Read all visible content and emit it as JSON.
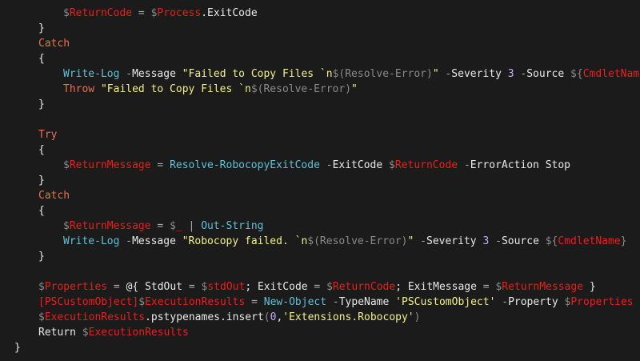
{
  "editor": {
    "language": "PowerShell",
    "colors": {
      "background": "#1b1b1b",
      "plain": "#e8e8e8",
      "variable": "#f01c1c",
      "keyword": "#e8714f",
      "command": "#5ec2d6",
      "string": "#f2f08a",
      "number": "#c9a8ff",
      "operator": "#a9a9a9"
    },
    "lines": [
      {
        "indent": 2,
        "tokens": [
          [
            "dollar",
            "$"
          ],
          [
            "var",
            "ReturnCode"
          ],
          [
            "op",
            " = "
          ],
          [
            "dollar",
            "$"
          ],
          [
            "var",
            "Process"
          ],
          [
            "plain",
            ".ExitCode"
          ]
        ]
      },
      {
        "indent": 1,
        "tokens": [
          [
            "plain",
            "}"
          ]
        ]
      },
      {
        "indent": 1,
        "tokens": [
          [
            "kw",
            "Catch"
          ]
        ]
      },
      {
        "indent": 1,
        "tokens": [
          [
            "plain",
            "{"
          ]
        ]
      },
      {
        "indent": 2,
        "tokens": [
          [
            "cmd",
            "Write-Log"
          ],
          [
            "op",
            " -"
          ],
          [
            "param",
            "Message "
          ],
          [
            "str",
            "\"Failed to Copy Files `n"
          ],
          [
            "dollar",
            "$"
          ],
          [
            "paren",
            "(Resolve-Error)"
          ],
          [
            "str",
            "\""
          ],
          [
            "op",
            " -"
          ],
          [
            "param",
            "Severity "
          ],
          [
            "num",
            "3"
          ],
          [
            "op",
            " -"
          ],
          [
            "param",
            "Source "
          ],
          [
            "dollar",
            "${"
          ],
          [
            "var",
            "CmdletName"
          ],
          [
            "dollar",
            "}"
          ]
        ]
      },
      {
        "indent": 2,
        "tokens": [
          [
            "kw",
            "Throw "
          ],
          [
            "str",
            "\"Failed to Copy Files `n"
          ],
          [
            "dollar",
            "$"
          ],
          [
            "paren",
            "(Resolve-Error)"
          ],
          [
            "str",
            "\""
          ]
        ]
      },
      {
        "indent": 1,
        "tokens": [
          [
            "plain",
            "}"
          ]
        ]
      },
      {
        "indent": 0,
        "tokens": []
      },
      {
        "indent": 1,
        "tokens": [
          [
            "kw",
            "Try"
          ]
        ]
      },
      {
        "indent": 1,
        "tokens": [
          [
            "plain",
            "{"
          ]
        ]
      },
      {
        "indent": 2,
        "tokens": [
          [
            "dollar",
            "$"
          ],
          [
            "var",
            "ReturnMessage"
          ],
          [
            "op",
            " = "
          ],
          [
            "cmd",
            "Resolve-RobocopyExitCode"
          ],
          [
            "op",
            " -"
          ],
          [
            "param",
            "ExitCode "
          ],
          [
            "dollar",
            "$"
          ],
          [
            "var",
            "ReturnCode"
          ],
          [
            "op",
            " -"
          ],
          [
            "param",
            "ErrorAction Stop"
          ]
        ]
      },
      {
        "indent": 1,
        "tokens": [
          [
            "plain",
            "}"
          ]
        ]
      },
      {
        "indent": 1,
        "tokens": [
          [
            "kw",
            "Catch"
          ]
        ]
      },
      {
        "indent": 1,
        "tokens": [
          [
            "plain",
            "{"
          ]
        ]
      },
      {
        "indent": 2,
        "tokens": [
          [
            "dollar",
            "$"
          ],
          [
            "var",
            "ReturnMessage"
          ],
          [
            "op",
            " = "
          ],
          [
            "dollar",
            "$"
          ],
          [
            "var",
            "_"
          ],
          [
            "op",
            " | "
          ],
          [
            "cmd",
            "Out-String"
          ]
        ]
      },
      {
        "indent": 2,
        "tokens": [
          [
            "cmd",
            "Write-Log"
          ],
          [
            "op",
            " -"
          ],
          [
            "param",
            "Message "
          ],
          [
            "str",
            "\"Robocopy failed. `n"
          ],
          [
            "dollar",
            "$"
          ],
          [
            "paren",
            "(Resolve-Error)"
          ],
          [
            "str",
            "\""
          ],
          [
            "op",
            " -"
          ],
          [
            "param",
            "Severity "
          ],
          [
            "num",
            "3"
          ],
          [
            "op",
            " -"
          ],
          [
            "param",
            "Source "
          ],
          [
            "dollar",
            "${"
          ],
          [
            "var",
            "CmdletName"
          ],
          [
            "dollar",
            "}"
          ]
        ]
      },
      {
        "indent": 1,
        "tokens": [
          [
            "plain",
            "}"
          ]
        ]
      },
      {
        "indent": 0,
        "tokens": []
      },
      {
        "indent": 1,
        "tokens": [
          [
            "dollar",
            "$"
          ],
          [
            "var",
            "Properties"
          ],
          [
            "op",
            " = "
          ],
          [
            "plain",
            "@{ StdOut "
          ],
          [
            "op",
            "= "
          ],
          [
            "dollar",
            "$"
          ],
          [
            "var",
            "stdOut"
          ],
          [
            "plain",
            "; ExitCode "
          ],
          [
            "op",
            "= "
          ],
          [
            "dollar",
            "$"
          ],
          [
            "var",
            "ReturnCode"
          ],
          [
            "plain",
            "; ExitMessage "
          ],
          [
            "op",
            "= "
          ],
          [
            "dollar",
            "$"
          ],
          [
            "var",
            "ReturnMessage"
          ],
          [
            "plain",
            " }"
          ]
        ]
      },
      {
        "indent": 1,
        "tokens": [
          [
            "type",
            "[PSCustomObject]"
          ],
          [
            "dollar",
            "$"
          ],
          [
            "var",
            "ExecutionResults"
          ],
          [
            "op",
            " = "
          ],
          [
            "cmd",
            "New-Object"
          ],
          [
            "op",
            " -"
          ],
          [
            "param",
            "TypeName "
          ],
          [
            "str",
            "'PSCustomObject'"
          ],
          [
            "op",
            " -"
          ],
          [
            "param",
            "Property "
          ],
          [
            "dollar",
            "$"
          ],
          [
            "var",
            "Properties"
          ]
        ]
      },
      {
        "indent": 1,
        "tokens": [
          [
            "dollar",
            "$"
          ],
          [
            "var",
            "ExecutionResults"
          ],
          [
            "plain",
            ".pstypenames.insert"
          ],
          [
            "paren",
            "("
          ],
          [
            "num",
            "0"
          ],
          [
            "plain",
            ","
          ],
          [
            "str",
            "'Extensions.Robocopy'"
          ],
          [
            "paren",
            ")"
          ]
        ]
      },
      {
        "indent": 1,
        "tokens": [
          [
            "plain",
            "Return "
          ],
          [
            "dollar",
            "$"
          ],
          [
            "var",
            "ExecutionResults"
          ]
        ]
      },
      {
        "indent": 0,
        "tokens": [
          [
            "plain",
            "}"
          ]
        ]
      }
    ]
  }
}
